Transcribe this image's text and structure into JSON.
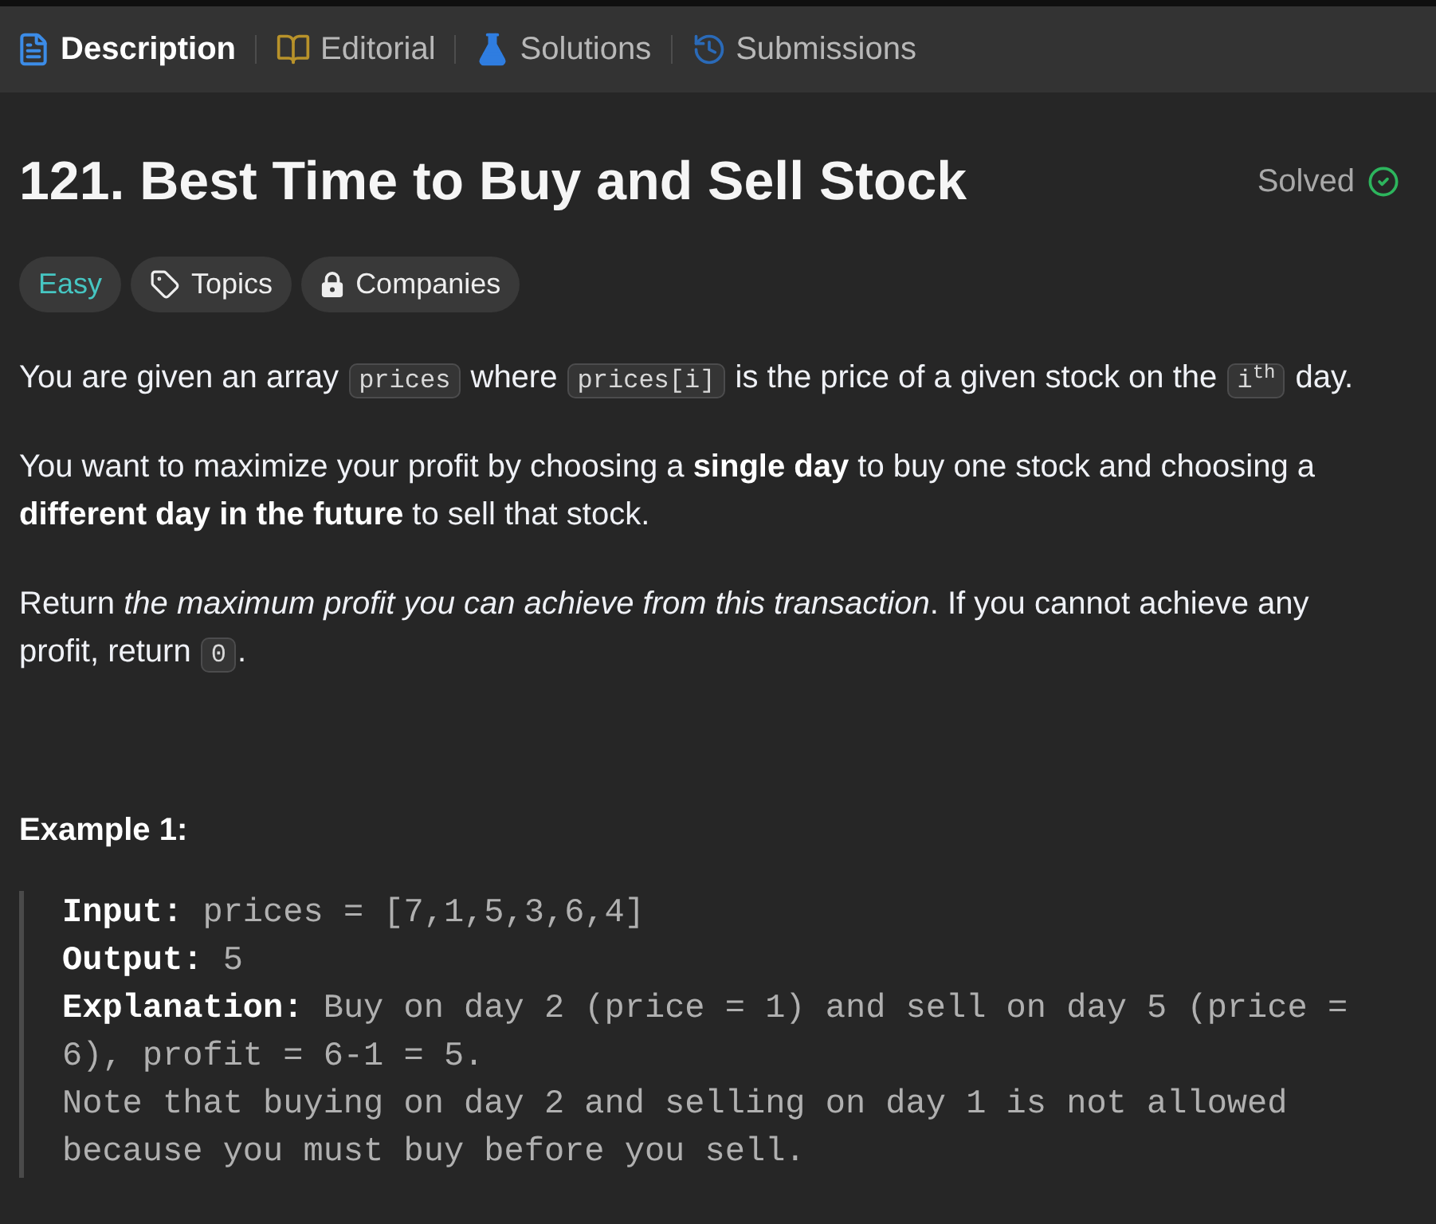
{
  "tabs": [
    {
      "label": "Description",
      "selected": true
    },
    {
      "label": "Editorial",
      "selected": false
    },
    {
      "label": "Solutions",
      "selected": false
    },
    {
      "label": "Submissions",
      "selected": false
    }
  ],
  "problem": {
    "title": "121. Best Time to Buy and Sell Stock",
    "status": "Solved",
    "tags": [
      {
        "kind": "difficulty",
        "label": "Easy"
      },
      {
        "kind": "topics",
        "label": "Topics"
      },
      {
        "kind": "companies",
        "label": "Companies"
      }
    ]
  },
  "paragraphs": [
    {
      "segments": [
        {
          "kind": "text",
          "text": "You are given an array "
        },
        {
          "kind": "code",
          "text": "prices"
        },
        {
          "kind": "text",
          "text": " where "
        },
        {
          "kind": "code",
          "text": "prices[i]"
        },
        {
          "kind": "text",
          "text": " is the price of a given stock on the "
        },
        {
          "kind": "code",
          "text": "i$^{th}$"
        },
        {
          "kind": "text",
          "text": " day."
        }
      ]
    },
    {
      "segments": [
        {
          "kind": "text",
          "text": "You want to maximize your profit by choosing a **single day** to buy one stock and choosing a **different day in the future** to sell that stock."
        }
      ]
    },
    {
      "segments": [
        {
          "kind": "text",
          "text": "Return *the maximum profit you can achieve from this transaction*. If you cannot achieve any profit, return "
        },
        {
          "kind": "code",
          "text": "0"
        },
        {
          "kind": "text",
          "text": "."
        }
      ]
    }
  ],
  "example": {
    "heading": "Example 1:",
    "lines": [
      "**Input:** prices = [7,1,5,3,6,4]",
      "**Output:** 5",
      "**Explanation:** Buy on day 2 (price = 1) and sell on day 5 (price = 6), profit = 6-1 = 5.",
      "Note that buying on day 2 and selling on day 1 is not allowed because you must buy before you sell."
    ]
  }
}
